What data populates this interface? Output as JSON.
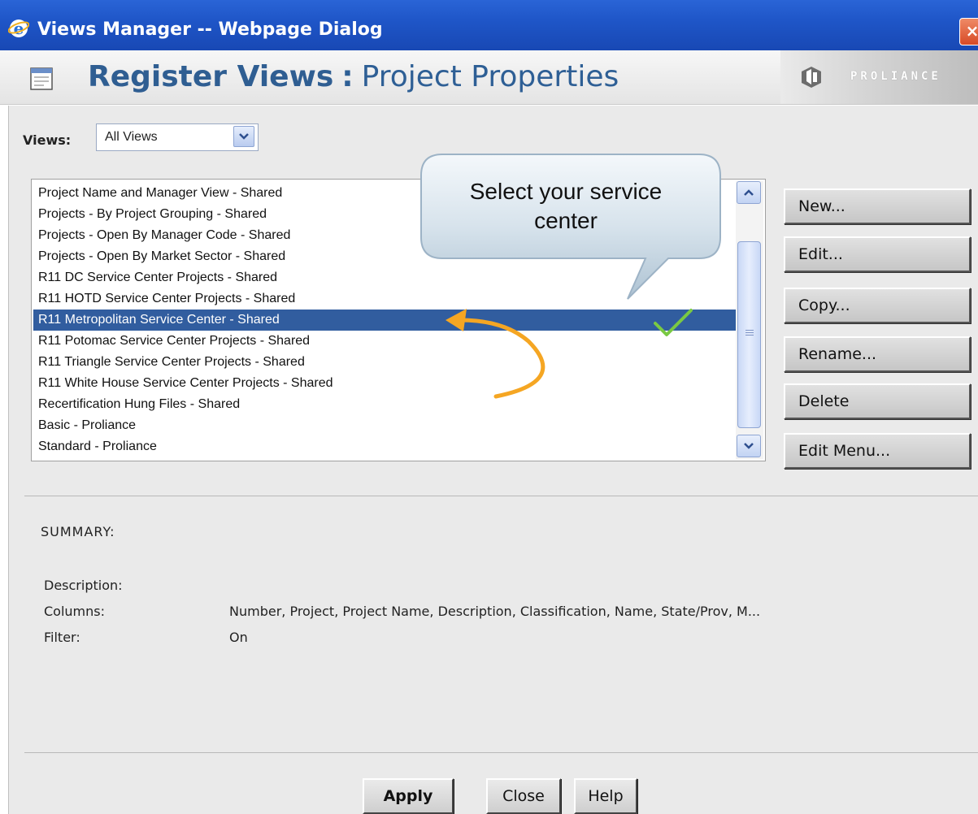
{
  "window": {
    "title": "Views Manager -- Webpage Dialog",
    "close_glyph": "×"
  },
  "header": {
    "title_bold": "Register Views",
    "separator": ":",
    "title_rest": "Project Properties",
    "brand": "PROLIANCE"
  },
  "views_filter": {
    "label": "Views:",
    "selected": "All Views"
  },
  "list": {
    "items": [
      "Project Name and Manager View - Shared",
      "Projects - By Project Grouping - Shared",
      "Projects - Open By Manager Code - Shared",
      "Projects - Open By Market Sector - Shared",
      "R11 DC Service Center Projects - Shared",
      "R11 HOTD Service Center Projects - Shared",
      "R11 Metropolitan Service Center - Shared",
      "R11 Potomac Service Center Projects - Shared",
      "R11 Triangle Service Center Projects - Shared",
      "R11 White House Service Center Projects - Shared",
      "Recertification Hung Files - Shared",
      "Basic - Proliance",
      "Standard - Proliance"
    ],
    "selected_index": 6
  },
  "actions": {
    "new": "New...",
    "edit": "Edit...",
    "copy": "Copy...",
    "rename": "Rename...",
    "delete": "Delete",
    "edit_menu": "Edit Menu..."
  },
  "summary": {
    "title": "SUMMARY:",
    "description_label": "Description:",
    "description_value": "",
    "columns_label": "Columns:",
    "columns_value": "Number, Project, Project Name, Description, Classification, Name, State/Prov, M...",
    "filter_label": "Filter:",
    "filter_value": "On"
  },
  "footer": {
    "apply": "Apply",
    "close": "Close",
    "help": "Help"
  },
  "annotation": {
    "callout_line1": "Select your service",
    "callout_line2": "center"
  },
  "colors": {
    "titlebar": "#1f56c8",
    "header_text": "#2e5f95",
    "selection": "#315d9f",
    "annotation_arrow": "#f5a623",
    "checkmark": "#7ac943"
  }
}
